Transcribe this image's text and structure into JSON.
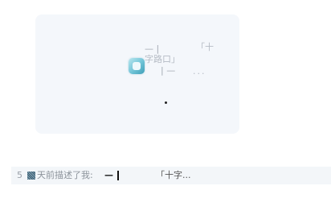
{
  "card": {
    "dash_top": "— |",
    "quote_1": "「十",
    "quote_2": "字路口」",
    "dash_bottom": "| —",
    "dots": "...",
    "icon": "app-icon"
  },
  "row": {
    "line_number": "5",
    "text": "天前描述了我:",
    "dash": "—",
    "quote_preview": "「十字..."
  },
  "colors": {
    "card_background": "#f4f7fb",
    "row_background": "#f3f6f9",
    "icon_accent": "#6fc3d6"
  }
}
